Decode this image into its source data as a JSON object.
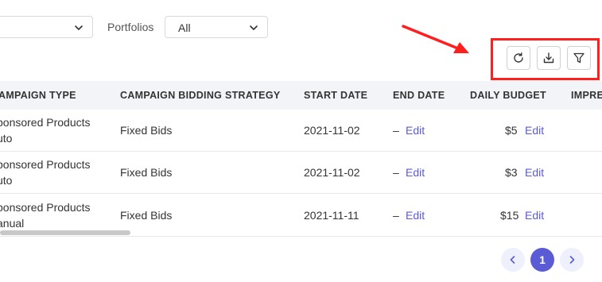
{
  "filters": {
    "first_select_value": "",
    "portfolios_label": "Portfolios",
    "portfolios_value": "All"
  },
  "toolbar": {
    "refresh_icon": "refresh-icon",
    "download_icon": "download-icon",
    "filter_icon": "filter-icon"
  },
  "annotation": {
    "arrow_color": "#ff1f1f",
    "frame_color": "#ff1f1f"
  },
  "table": {
    "columns": [
      "AMPAIGN TYPE",
      "CAMPAIGN BIDDING STRATEGY",
      "START DATE",
      "END DATE",
      "DAILY BUDGET",
      "IMPRE"
    ],
    "rows": [
      {
        "type_line1": "ponsored Products",
        "type_line2": "uto",
        "strategy": "Fixed Bids",
        "start": "2021-11-02",
        "end_dash": "–",
        "end_edit": "Edit",
        "budget": "$5",
        "budget_edit": "Edit"
      },
      {
        "type_line1": "ponsored Products",
        "type_line2": "uto",
        "strategy": "Fixed Bids",
        "start": "2021-11-02",
        "end_dash": "–",
        "end_edit": "Edit",
        "budget": "$3",
        "budget_edit": "Edit"
      },
      {
        "type_line1": "ponsored Products",
        "type_line2": "anual",
        "strategy": "Fixed Bids",
        "start": "2021-11-11",
        "end_dash": "–",
        "end_edit": "Edit",
        "budget": "$15",
        "budget_edit": "Edit"
      }
    ]
  },
  "pagination": {
    "current_page": "1"
  },
  "colors": {
    "accent": "#5b5bd6",
    "header_bg": "#f3f4f8"
  }
}
